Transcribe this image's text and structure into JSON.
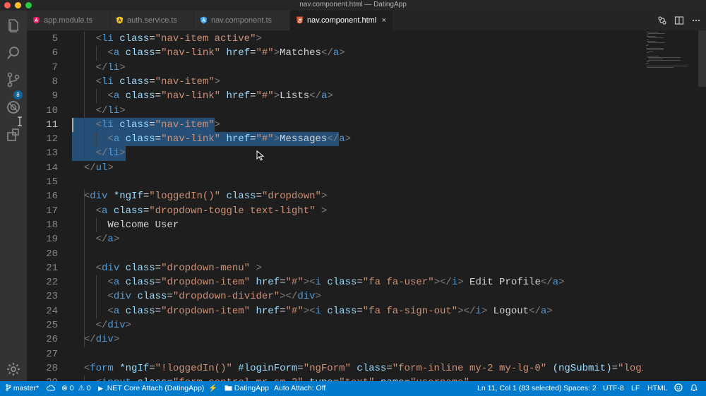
{
  "window": {
    "title": "nav.component.html — DatingApp"
  },
  "activity_bar": {
    "scm_badge": "8"
  },
  "tabs": [
    {
      "label": "app.module.ts",
      "icon": "angular-file-icon",
      "color": "#e91e63"
    },
    {
      "label": "auth.service.ts",
      "icon": "angular-service-icon",
      "color": "#ffca28"
    },
    {
      "label": "nav.component.ts",
      "icon": "angular-component-icon",
      "color": "#42a5f5"
    },
    {
      "label": "nav.component.html",
      "icon": "html-file-icon",
      "color": "#e44d26",
      "close": "×"
    }
  ],
  "editor": {
    "first_line": 5,
    "current_line": 11,
    "lines": [
      "    <li class=\"nav-item active\">",
      "      <a class=\"nav-link\" href=\"#\">Matches</a>",
      "    </li>",
      "    <li class=\"nav-item\">",
      "      <a class=\"nav-link\" href=\"#\">Lists</a>",
      "    </li>",
      "    <li class=\"nav-item\">",
      "      <a class=\"nav-link\" href=\"#\">Messages</a>",
      "    </li>",
      "  </ul>",
      "",
      "  <div *ngIf=\"loggedIn()\" class=\"dropdown\">",
      "    <a class=\"dropdown-toggle text-light\" >",
      "      Welcome User",
      "    </a>",
      "",
      "    <div class=\"dropdown-menu\" >",
      "      <a class=\"dropdown-item\" href=\"#\"><i class=\"fa fa-user\"></i> Edit Profile</a>",
      "      <div class=\"dropdown-divider\"></div>",
      "      <a class=\"dropdown-item\" href=\"#\"><i class=\"fa fa-sign-out\"></i> Logout</a>",
      "    </div>",
      "  </div>",
      "",
      "  <form *ngIf=\"!loggedIn()\" #loginForm=\"ngForm\" class=\"form-inline my-2 my-lg-0\" (ngSubmit)=\"login()\">",
      "    <input class=\"form-control mr-sm-2\" type=\"text\" name=\"username\""
    ]
  },
  "status_bar": {
    "branch": "master*",
    "errors": "0",
    "warnings": "0",
    "debug": ".NET Core Attach (DatingApp)",
    "folder": "DatingApp",
    "auto_attach": "Auto Attach: Off",
    "position": "Ln 11, Col 1 (83 selected)",
    "spaces": "Spaces: 2",
    "encoding": "UTF-8",
    "eol": "LF",
    "language": "HTML"
  },
  "colors": {
    "tag": "#569cd6",
    "attribute": "#9cdcfe",
    "string": "#ce9178",
    "text": "#d4d4d4",
    "selection": "#264f78",
    "statusbar": "#007acc"
  }
}
